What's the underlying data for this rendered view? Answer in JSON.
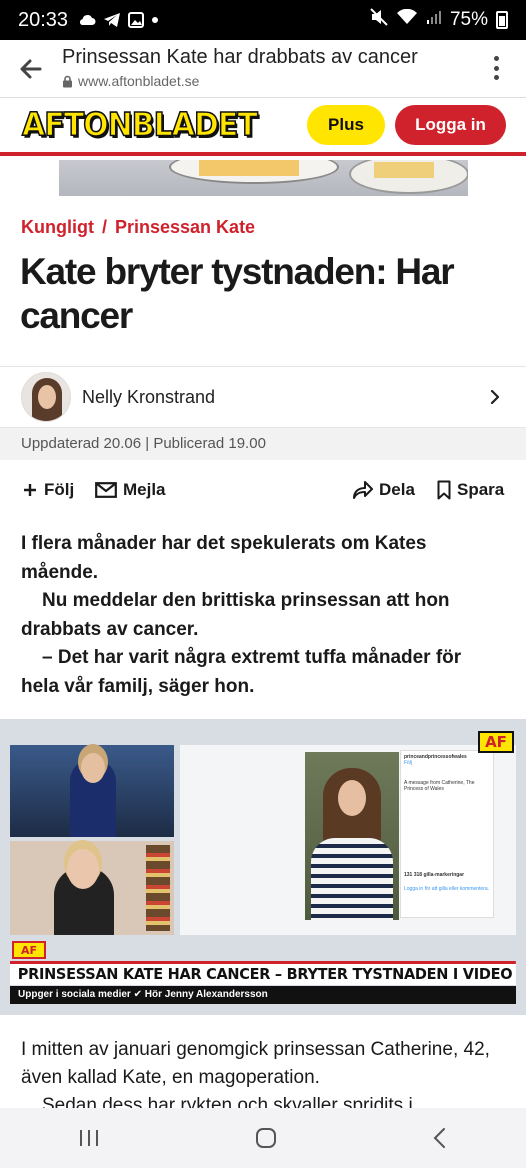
{
  "status_bar": {
    "time": "20:33",
    "battery": "75%",
    "icons": [
      "cloud-icon",
      "telegram-icon",
      "image-icon",
      "dot-icon",
      "mute-icon",
      "wifi-icon",
      "signal-icon",
      "battery-icon"
    ]
  },
  "browser": {
    "page_title": "Prinsessan Kate har drabbats av cancer",
    "url": "www.aftonbladet.se"
  },
  "site_header": {
    "logo": "AFTONBLADET",
    "plus_label": "Plus",
    "login_label": "Logga in",
    "brand_yellow": "#ffe500",
    "brand_red": "#d0222c"
  },
  "article": {
    "breadcrumb": [
      "Kungligt",
      "Prinsessan Kate"
    ],
    "breadcrumb_sep": "/",
    "headline": "Kate bryter tystnaden: Har cancer",
    "author": "Nelly Kronstrand",
    "dates": "Uppdaterad 20.06 | Publicerad 19.00",
    "actions": {
      "follow": "Följ",
      "mail": "Mejla",
      "share": "Dela",
      "save": "Spara"
    },
    "lead": [
      "I flera månader har det spekulerats om Kates mående.",
      "Nu meddelar den brittiska prinsessan att hon drabbats av cancer.",
      "– Det har varit några extremt tuffa månader för hela vår familj, säger hon."
    ],
    "video": {
      "badge": "AF",
      "lower_tag": "AF",
      "headline": "PRINSESSAN KATE HAR CANCER – BRYTER TYSTNADEN I VIDEO",
      "subline": "Uppger i sociala medier ✔ Hör Jenny Alexandersson",
      "panel_account": "princeandprincessofwales",
      "panel_follow": "Följ",
      "panel_caption": "A message from Catherine, The Princess of Wales",
      "panel_likes": "131 318 gilla-markeringar",
      "panel_login": "Logga in för att gilla eller kommentera."
    },
    "body": [
      "I mitten av januari genomgick prinsessan Catherine, 42, även kallad Kate, en magoperation.",
      "Sedan dess har rykten och skvaller spridits i"
    ]
  }
}
